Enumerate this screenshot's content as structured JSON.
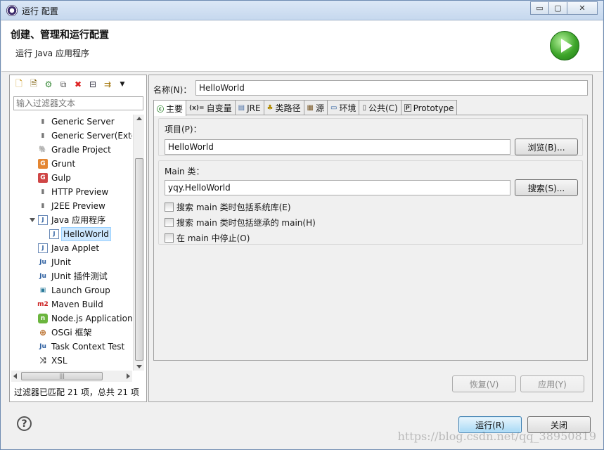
{
  "window": {
    "title": "运行 配置",
    "controls": {
      "minimize": "▭",
      "maximize": "▢",
      "close": "✕"
    }
  },
  "header": {
    "title": "创建、管理和运行配置",
    "subtitle": "运行 Java 应用程序"
  },
  "left": {
    "filter_placeholder": "输入过滤器文本",
    "tree": [
      {
        "label": "Generic Server",
        "icon": "server-icon"
      },
      {
        "label": "Generic Server(Extern",
        "icon": "server-icon"
      },
      {
        "label": "Gradle Project",
        "icon": "gradle-icon"
      },
      {
        "label": "Grunt",
        "icon": "grunt-icon"
      },
      {
        "label": "Gulp",
        "icon": "gulp-icon"
      },
      {
        "label": "HTTP Preview",
        "icon": "http-icon"
      },
      {
        "label": "J2EE Preview",
        "icon": "j2ee-icon"
      },
      {
        "label": "Java 应用程序",
        "icon": "java-app-icon"
      },
      {
        "label": "HelloWorld",
        "icon": "java-file-icon"
      },
      {
        "label": "Java Applet",
        "icon": "applet-icon"
      },
      {
        "label": "JUnit",
        "icon": "junit-icon"
      },
      {
        "label": "JUnit 插件测试",
        "icon": "junit-plugin-icon"
      },
      {
        "label": "Launch Group",
        "icon": "launch-group-icon"
      },
      {
        "label": "Maven Build",
        "icon": "maven-icon"
      },
      {
        "label": "Node.js Application",
        "icon": "nodejs-icon"
      },
      {
        "label": "OSGi 框架",
        "icon": "osgi-icon"
      },
      {
        "label": "Task Context Test",
        "icon": "task-icon"
      },
      {
        "label": "XSL",
        "icon": "xsl-icon"
      }
    ],
    "status": "过滤器已匹配 21 项，总共 21 项"
  },
  "right": {
    "name_label": "名称(N)：",
    "name_value": "HelloWorld",
    "tabs": [
      {
        "label": "主要",
        "icon": "main-tab-icon"
      },
      {
        "label": "自变量",
        "icon": "arguments-icon"
      },
      {
        "label": "JRE",
        "icon": "jre-icon"
      },
      {
        "label": "类路径",
        "icon": "classpath-icon"
      },
      {
        "label": "源",
        "icon": "source-icon"
      },
      {
        "label": "环境",
        "icon": "environment-icon"
      },
      {
        "label": "公共(C)",
        "icon": "common-icon"
      },
      {
        "label": "Prototype",
        "icon": "prototype-icon"
      }
    ],
    "project_label": "项目(P)：",
    "project_value": "HelloWorld",
    "browse_label": "浏览(B)...",
    "main_class_label": "Main 类：",
    "main_class_value": "yqy.HelloWorld",
    "search_label": "搜索(S)...",
    "checkboxes": [
      {
        "label": "搜索 main 类时包括系统库(E)",
        "checked": false
      },
      {
        "label": "搜索 main 类时包括继承的 main(H)",
        "checked": false
      },
      {
        "label": "在 main 中停止(O)",
        "checked": false
      }
    ],
    "revert_label": "恢复(V)",
    "apply_label": "应用(Y)"
  },
  "footer": {
    "run_label": "运行(R)",
    "close_label": "关闭"
  },
  "watermark": "https://blog.csdn.net/qq_38950819"
}
